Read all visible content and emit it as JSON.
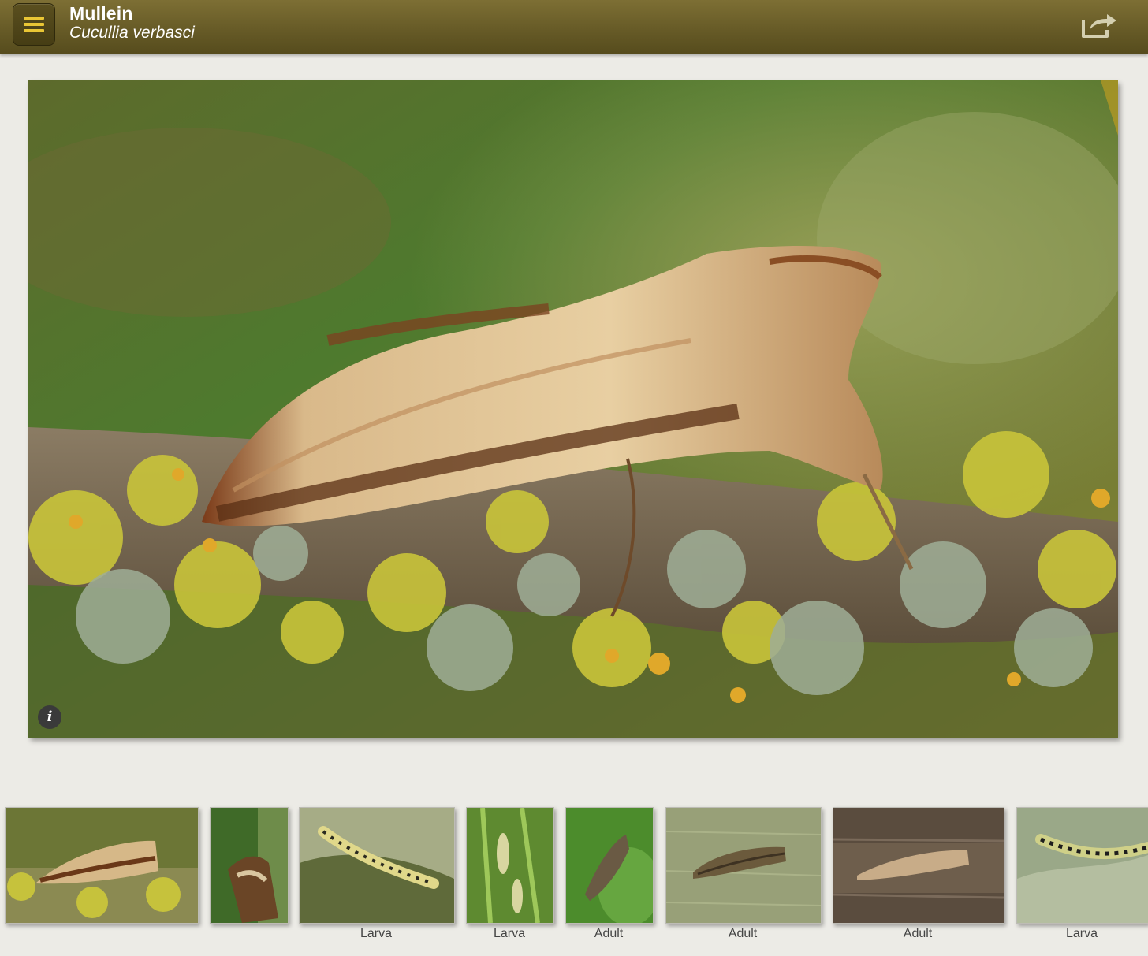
{
  "header": {
    "common_name": "Mullein",
    "scientific_name": "Cucullia verbasci"
  },
  "icons": {
    "menu": "hamburger-menu-icon",
    "share": "share-icon",
    "info": "info-icon"
  },
  "main_photo": {
    "info_glyph": "i"
  },
  "gallery": [
    {
      "caption": ""
    },
    {
      "caption": ""
    },
    {
      "caption": "Larva"
    },
    {
      "caption": "Larva"
    },
    {
      "caption": "Adult"
    },
    {
      "caption": "Adult"
    },
    {
      "caption": "Adult"
    },
    {
      "caption": "Larva"
    }
  ],
  "colors": {
    "header_bar": "#675b27",
    "menu_bars": "#e9c635",
    "background": "#ecebe6"
  }
}
